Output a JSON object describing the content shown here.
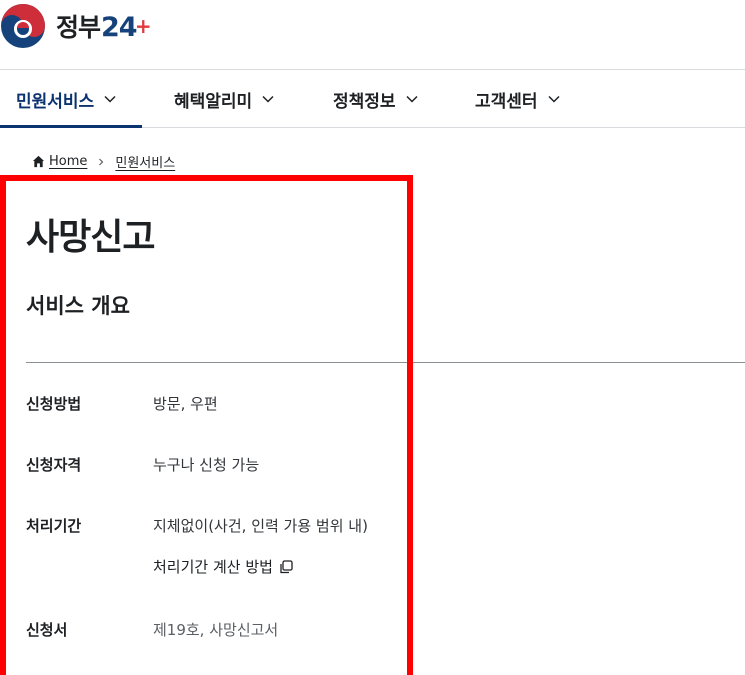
{
  "header": {
    "logo_text": "정부",
    "logo_num": "24",
    "logo_plus": "+"
  },
  "nav": {
    "items": [
      {
        "label": "민원서비스"
      },
      {
        "label": "혜택알리미"
      },
      {
        "label": "정책정보"
      },
      {
        "label": "고객센터"
      }
    ]
  },
  "breadcrumb": {
    "home": "Home",
    "current": "민원서비스"
  },
  "page": {
    "title": "사망신고",
    "section_title": "서비스 개요"
  },
  "details": {
    "method_label": "신청방법",
    "method_value": "방문, 우편",
    "eligibility_label": "신청자격",
    "eligibility_value": "누구나 신청 가능",
    "period_label": "처리기간",
    "period_value": "지체없이(사건, 인력 가용 범위 내)",
    "period_link": "처리기간 계산 방법",
    "form_label": "신청서",
    "form_value": "제19호, 사망신고서"
  },
  "colors": {
    "brand_navy": "#0b3370",
    "accent_red": "#ff0000"
  },
  "icons": [
    "taeguk-logo-icon",
    "chevron-down-icon",
    "home-icon",
    "chevron-right-icon",
    "copy-icon"
  ]
}
